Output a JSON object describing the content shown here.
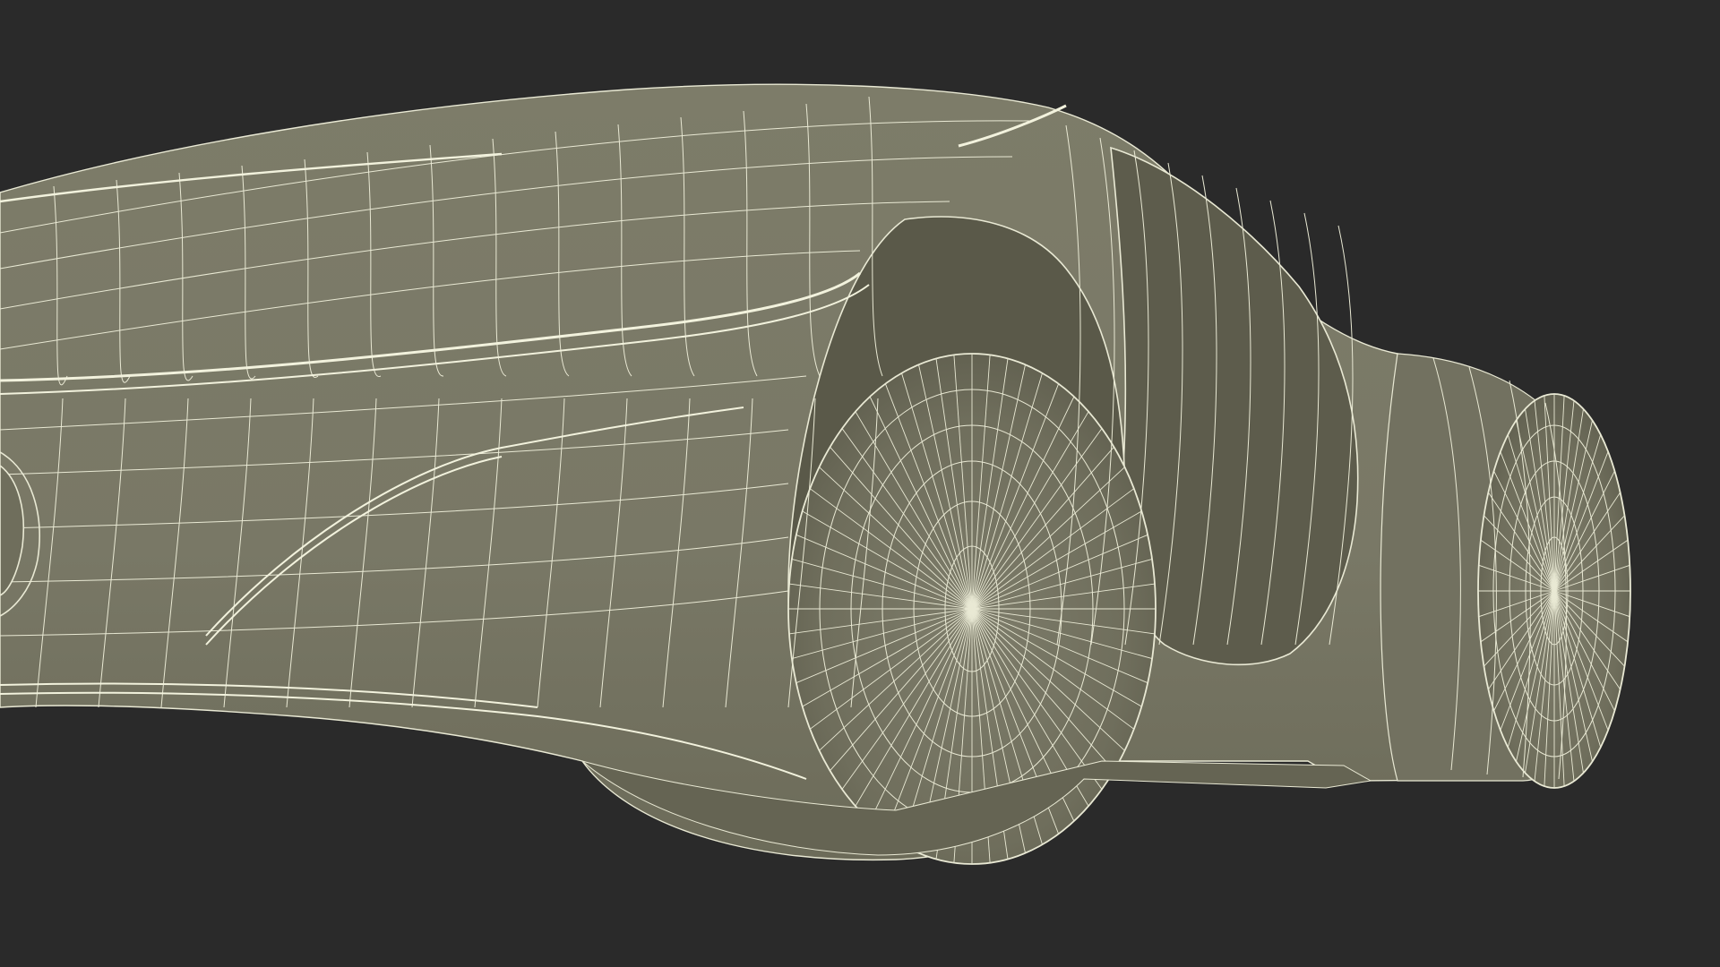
{
  "scene": {
    "subject_icon": "car-wireframe-icon",
    "colors": {
      "background": "#2a2a2a",
      "surface": "#797866",
      "surface_shade": "#686755",
      "surface_deep": "#5d5c4c",
      "wire": "#e9e9d4"
    }
  }
}
